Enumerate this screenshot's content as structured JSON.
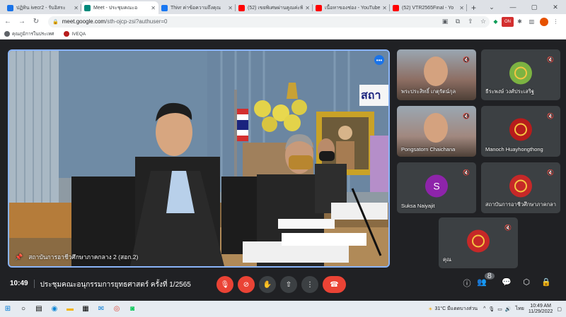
{
  "browser": {
    "tabs": [
      {
        "title": "ปฏิทิน ivecr2 - รับอิสระ",
        "icon": "calendar-icon",
        "color": "#1a73e8",
        "active": false
      },
      {
        "title": "Meet - ประชุมคณะอ",
        "icon": "meet-icon",
        "color": "#00897b",
        "active": true
      },
      {
        "title": "Thivr ค่าข้อความถึงคุณ",
        "icon": "facebook-icon",
        "color": "#1877f2",
        "active": false
      },
      {
        "title": "(52) เขยพิเศษผ่านคูณค่ะพิ",
        "icon": "youtube-icon",
        "color": "#ff0000",
        "active": false
      },
      {
        "title": "เนื้อหาของช่อง - YouTube",
        "icon": "youtube-icon",
        "color": "#ff0000",
        "active": false
      },
      {
        "title": "(52) VTR2565Final - Yo",
        "icon": "youtube-icon",
        "color": "#ff0000",
        "active": false
      }
    ],
    "url_domain": "meet.google.com",
    "url_path": "/sth-ojcp-zsi?authuser=0",
    "bookmarks": [
      {
        "label": "คุณภูมิการในประเทศ",
        "color": "#5f6368"
      },
      {
        "label": "IVEQA",
        "color": "#b71c1c"
      }
    ]
  },
  "meet": {
    "main_speaker": "สถาบันการอาชีวศึกษาภาคกลาง 2 (สอก.2)",
    "participants": [
      {
        "name": "พระประสิทธิ์ เกตุรัตน์กุล",
        "avatar": "video",
        "color": "#8d6e63"
      },
      {
        "name": "ธีระพงษ์ วงศ์ประเสริฐ",
        "avatar": "",
        "color": "#7cb342"
      },
      {
        "name": "Pongsatorn Chaichana",
        "avatar": "video",
        "color": "#a1887f"
      },
      {
        "name": "Manoch Huayhongthong",
        "avatar": "",
        "color": "#b71c1c"
      },
      {
        "name": "Suksa Naiyajit",
        "avatar": "S",
        "color": "#8e24aa"
      },
      {
        "name": "สถาบันการอาชีวศึกษาภาคกลาง",
        "avatar": "",
        "color": "#c62828"
      },
      {
        "name": "คุณ",
        "avatar": "",
        "color": "#c62828"
      }
    ],
    "time": "10:49",
    "meeting_title": "ประชุมคณะอนุกรรมการยุทธศาสตร์ ครั้งที่ 1/2565",
    "people_count": "8"
  },
  "taskbar": {
    "weather": "31°C มีแดดบางส่วน",
    "language": "ไทย",
    "clock_time": "10:49 AM",
    "clock_date": "11/29/2022"
  }
}
